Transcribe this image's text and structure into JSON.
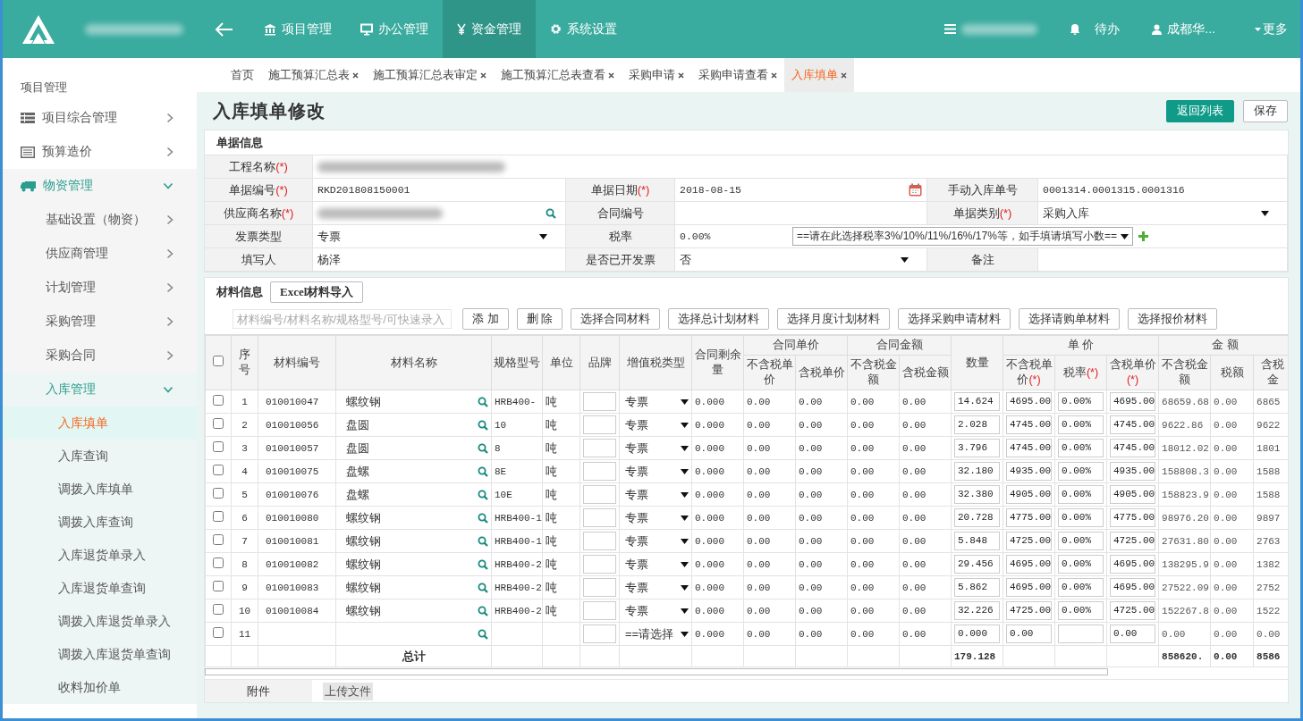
{
  "header": {
    "nav": [
      {
        "label": "项目管理",
        "selected": false
      },
      {
        "label": "办公管理",
        "selected": false
      },
      {
        "label": "资金管理",
        "selected": true
      },
      {
        "label": "系统设置",
        "selected": false
      }
    ],
    "todo": "待办",
    "user": "成都华...",
    "more": "更多"
  },
  "sidebar": {
    "heading": "项目管理",
    "items": [
      {
        "label": "项目综合管理",
        "kind": "group",
        "expanded": false
      },
      {
        "label": "预算造价",
        "kind": "group",
        "expanded": false
      },
      {
        "label": "物资管理",
        "kind": "group",
        "expanded": true,
        "children": [
          {
            "label": "基础设置（物资）",
            "kind": "group",
            "expanded": false
          },
          {
            "label": "供应商管理",
            "kind": "group",
            "expanded": false
          },
          {
            "label": "计划管理",
            "kind": "group",
            "expanded": false
          },
          {
            "label": "采购管理",
            "kind": "group",
            "expanded": false
          },
          {
            "label": "采购合同",
            "kind": "group",
            "expanded": false
          },
          {
            "label": "入库管理",
            "kind": "group",
            "expanded": true,
            "children": [
              {
                "label": "入库填单",
                "kind": "page",
                "selected": true
              },
              {
                "label": "入库查询",
                "kind": "page",
                "selected": false
              },
              {
                "label": "调拨入库填单",
                "kind": "page",
                "selected": false
              },
              {
                "label": "调拨入库查询",
                "kind": "page",
                "selected": false
              },
              {
                "label": "入库退货单录入",
                "kind": "page",
                "selected": false
              },
              {
                "label": "入库退货单查询",
                "kind": "page",
                "selected": false
              },
              {
                "label": "调拨入库退货单录入",
                "kind": "page",
                "selected": false
              },
              {
                "label": "调拨入库退货单查询",
                "kind": "page",
                "selected": false
              },
              {
                "label": "收料加价单",
                "kind": "page",
                "selected": false
              }
            ]
          }
        ]
      }
    ]
  },
  "tabs": [
    {
      "label": "首页",
      "closable": false,
      "selected": false
    },
    {
      "label": "施工预算汇总表",
      "closable": true,
      "selected": false
    },
    {
      "label": "施工预算汇总表审定",
      "closable": true,
      "selected": false
    },
    {
      "label": "施工预算汇总表查看",
      "closable": true,
      "selected": false
    },
    {
      "label": "采购申请",
      "closable": true,
      "selected": false
    },
    {
      "label": "采购申请查看",
      "closable": true,
      "selected": false
    },
    {
      "label": "入库填单",
      "closable": true,
      "selected": true
    }
  ],
  "page": {
    "title": "入库填单修改",
    "buttons": [
      {
        "label": "返回列表",
        "kind": "primary"
      },
      {
        "label": "保存",
        "kind": "default"
      }
    ]
  },
  "form": {
    "title": "单据信息",
    "rows": [
      [
        {
          "label": "工程名称",
          "mark": "(*)",
          "kind": "redacted"
        }
      ],
      [
        {
          "label": "单据编号",
          "mark": "(*)",
          "kind": "text",
          "value": "RKD201808150001"
        },
        {
          "label": "单据日期",
          "mark": "(*)",
          "kind": "date",
          "value": "2018-08-15"
        },
        {
          "label": "手动入库单号",
          "kind": "text",
          "value": "0001314.0001315.0001316"
        }
      ],
      [
        {
          "label": "供应商名称",
          "mark": "(*)",
          "kind": "redacted_search"
        },
        {
          "label": "合同编号",
          "kind": "text"
        },
        {
          "label": "单据类别",
          "mark": "(*)",
          "kind": "select",
          "value": "采购入库"
        }
      ],
      [
        {
          "label": "发票类型",
          "kind": "select",
          "value": "专票"
        },
        {
          "label": "税率",
          "kind": "tax",
          "value": "0.00%",
          "option": "==请在此选择税率3%/10%/11%/16%/17%等，如手填请填写小数=="
        }
      ],
      [
        {
          "label": "填写人",
          "kind": "text",
          "value": "杨泽"
        },
        {
          "label": "是否已开发票",
          "kind": "select",
          "value": "否"
        },
        {
          "label": "备注",
          "kind": "text"
        }
      ]
    ]
  },
  "materials": {
    "title": "材料信息",
    "import_button": "Excel材料导入",
    "search_placeholder": "材料编号/材料名称/规格型号/可快速录入",
    "buttons": [
      "添 加",
      "删 除",
      "选择合同材料",
      "选择总计划材料",
      "选择月度计划材料",
      "选择采购申请材料",
      "选择请购单材料",
      "选择报价材料"
    ],
    "table": {
      "all_checked": false,
      "columns": [
        {
          "label": "序号"
        },
        {
          "label": "材料编号"
        },
        {
          "label": "材料名称"
        },
        {
          "label": "规格型号"
        },
        {
          "label": "单位"
        },
        {
          "label": "品牌"
        },
        {
          "label": "增值税类型"
        },
        {
          "label": "合同剩余量"
        },
        {
          "label": "合同单价",
          "children": [
            {
              "label": "不含税单价"
            },
            {
              "label": "含税单价"
            }
          ]
        },
        {
          "label": "合同金额",
          "children": [
            {
              "label": "不含税金额"
            },
            {
              "label": "含税金额"
            }
          ]
        },
        {
          "label": "数量"
        },
        {
          "label": "单 价",
          "children": [
            {
              "label": "不含税单价",
              "mark": "(*)"
            },
            {
              "label": "税率",
              "mark": "(*)"
            },
            {
              "label": "含税单价",
              "mark": "(*)"
            }
          ]
        },
        {
          "label": "金 额",
          "children": [
            {
              "label": "不含税金额"
            },
            {
              "label": "税额"
            },
            {
              "label": "含税金"
            }
          ]
        }
      ],
      "rows": [
        {
          "checked": false,
          "no": "1",
          "code": "010010047",
          "name": "螺纹钢",
          "spec": "HRB400-",
          "unit": "吨",
          "vat": "专票",
          "remain": "0.000",
          "cp_ex": "0.00",
          "cp_inc": "0.00",
          "ca_ex": "0.00",
          "ca_inc": "0.00",
          "qty": "14.624",
          "p_ex": "4695.00",
          "rate": "0.00%",
          "p_inc": "4695.00",
          "a_ex": "68659.68",
          "tax": "0.00",
          "a_inc": "6865"
        },
        {
          "checked": false,
          "no": "2",
          "code": "010010056",
          "name": "盘圆",
          "spec": "10",
          "unit": "吨",
          "vat": "专票",
          "remain": "0.000",
          "cp_ex": "0.00",
          "cp_inc": "0.00",
          "ca_ex": "0.00",
          "ca_inc": "0.00",
          "qty": "2.028",
          "p_ex": "4745.00",
          "rate": "0.00%",
          "p_inc": "4745.00",
          "a_ex": "9622.86",
          "tax": "0.00",
          "a_inc": "9622"
        },
        {
          "checked": false,
          "no": "3",
          "code": "010010057",
          "name": "盘圆",
          "spec": "8",
          "unit": "吨",
          "vat": "专票",
          "remain": "0.000",
          "cp_ex": "0.00",
          "cp_inc": "0.00",
          "ca_ex": "0.00",
          "ca_inc": "0.00",
          "qty": "3.796",
          "p_ex": "4745.00",
          "rate": "0.00%",
          "p_inc": "4745.00",
          "a_ex": "18012.02",
          "tax": "0.00",
          "a_inc": "1801"
        },
        {
          "checked": false,
          "no": "4",
          "code": "010010075",
          "name": "盘螺",
          "spec": "8E",
          "unit": "吨",
          "vat": "专票",
          "remain": "0.000",
          "cp_ex": "0.00",
          "cp_inc": "0.00",
          "ca_ex": "0.00",
          "ca_inc": "0.00",
          "qty": "32.180",
          "p_ex": "4935.00",
          "rate": "0.00%",
          "p_inc": "4935.00",
          "a_ex": "158808.3",
          "tax": "0.00",
          "a_inc": "1588"
        },
        {
          "checked": false,
          "no": "5",
          "code": "010010076",
          "name": "盘螺",
          "spec": "10E",
          "unit": "吨",
          "vat": "专票",
          "remain": "0.000",
          "cp_ex": "0.00",
          "cp_inc": "0.00",
          "ca_ex": "0.00",
          "ca_inc": "0.00",
          "qty": "32.380",
          "p_ex": "4905.00",
          "rate": "0.00%",
          "p_inc": "4905.00",
          "a_ex": "158823.9",
          "tax": "0.00",
          "a_inc": "1588"
        },
        {
          "checked": false,
          "no": "6",
          "code": "010010080",
          "name": "螺纹钢",
          "spec": "HRB400-1",
          "unit": "吨",
          "vat": "专票",
          "remain": "0.000",
          "cp_ex": "0.00",
          "cp_inc": "0.00",
          "ca_ex": "0.00",
          "ca_inc": "0.00",
          "qty": "20.728",
          "p_ex": "4775.00",
          "rate": "0.00%",
          "p_inc": "4775.00",
          "a_ex": "98976.20",
          "tax": "0.00",
          "a_inc": "9897"
        },
        {
          "checked": false,
          "no": "7",
          "code": "010010081",
          "name": "螺纹钢",
          "spec": "HRB400-1",
          "unit": "吨",
          "vat": "专票",
          "remain": "0.000",
          "cp_ex": "0.00",
          "cp_inc": "0.00",
          "ca_ex": "0.00",
          "ca_inc": "0.00",
          "qty": "5.848",
          "p_ex": "4725.00",
          "rate": "0.00%",
          "p_inc": "4725.00",
          "a_ex": "27631.80",
          "tax": "0.00",
          "a_inc": "2763"
        },
        {
          "checked": false,
          "no": "8",
          "code": "010010082",
          "name": "螺纹钢",
          "spec": "HRB400-2",
          "unit": "吨",
          "vat": "专票",
          "remain": "0.000",
          "cp_ex": "0.00",
          "cp_inc": "0.00",
          "ca_ex": "0.00",
          "ca_inc": "0.00",
          "qty": "29.456",
          "p_ex": "4695.00",
          "rate": "0.00%",
          "p_inc": "4695.00",
          "a_ex": "138295.9",
          "tax": "0.00",
          "a_inc": "1382"
        },
        {
          "checked": false,
          "no": "9",
          "code": "010010083",
          "name": "螺纹钢",
          "spec": "HRB400-2",
          "unit": "吨",
          "vat": "专票",
          "remain": "0.000",
          "cp_ex": "0.00",
          "cp_inc": "0.00",
          "ca_ex": "0.00",
          "ca_inc": "0.00",
          "qty": "5.862",
          "p_ex": "4695.00",
          "rate": "0.00%",
          "p_inc": "4695.00",
          "a_ex": "27522.09",
          "tax": "0.00",
          "a_inc": "2752"
        },
        {
          "checked": false,
          "no": "10",
          "code": "010010084",
          "name": "螺纹钢",
          "spec": "HRB400-2",
          "unit": "吨",
          "vat": "专票",
          "remain": "0.000",
          "cp_ex": "0.00",
          "cp_inc": "0.00",
          "ca_ex": "0.00",
          "ca_inc": "0.00",
          "qty": "32.226",
          "p_ex": "4725.00",
          "rate": "0.00%",
          "p_inc": "4725.00",
          "a_ex": "152267.8",
          "tax": "0.00",
          "a_inc": "1522"
        },
        {
          "checked": false,
          "no": "11",
          "vat": "==请选择",
          "remain": "0.000",
          "cp_ex": "0.00",
          "cp_inc": "0.00",
          "ca_ex": "0.00",
          "ca_inc": "0.00",
          "qty": "0.000",
          "p_ex": "0.00",
          "p_inc": "0.00",
          "a_ex": "0.00",
          "tax": "0.00",
          "a_inc": "0.00"
        }
      ],
      "totals": {
        "label": "总计",
        "qty": "179.128",
        "a_ex": "858620.",
        "tax": "0.00",
        "a_inc": "8586"
      }
    },
    "attachment": {
      "label": "附件",
      "button": "上传文件"
    }
  }
}
